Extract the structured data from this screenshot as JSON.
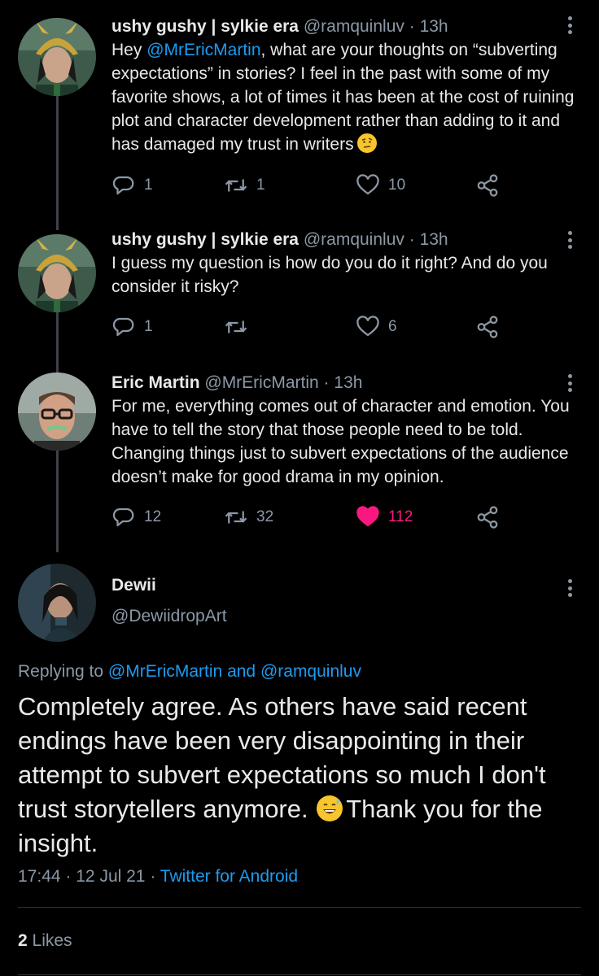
{
  "thread": [
    {
      "name": "ushy gushy | sylkie era",
      "handle": "@ramquinluv",
      "separator": "·",
      "time": "13h",
      "text_before": "Hey ",
      "text_mention": "@MrEricMartin",
      "text_after": ", what are your thoughts on “subverting expectations” in stories? I feel in the past with some of my favorite shows, a lot of times it has been at the cost of ruining plot and character development rather than adding to it and has damaged my trust in writers",
      "emoji": "face-with-raised-eyebrow-icon",
      "replies": "1",
      "retweets": "1",
      "likes": "10",
      "liked": false
    },
    {
      "name": "ushy gushy | sylkie era",
      "handle": "@ramquinluv",
      "separator": "·",
      "time": "13h",
      "text": "I guess my question is how do you do it right? And do you consider it risky?",
      "replies": "1",
      "retweets": "",
      "likes": "6",
      "liked": false
    },
    {
      "name": "Eric Martin",
      "handle": "@MrEricMartin",
      "separator": "·",
      "time": "13h",
      "text": "For me, everything comes out of character and emotion. You have to tell the story that those people need to be told. Changing things just to subvert expectations of the audience doesn’t make for good drama in my opinion.",
      "replies": "12",
      "retweets": "32",
      "likes": "112",
      "liked": true
    }
  ],
  "main_tweet": {
    "name": "Dewii",
    "handle": "@DewiidropArt",
    "replying_prefix": "Replying to ",
    "replying_user1": "@MrEricMartin",
    "replying_and": " and ",
    "replying_user2": "@ramquinluv",
    "text_before": "Completely agree. As others have said recent endings have been very disappointing in their attempt to subvert expectations so much I don't trust storytellers anymore.",
    "emoji": "grinning-face-with-sweat-icon",
    "text_after": "Thank you for the insight.",
    "time": "17:44",
    "dot": "·",
    "date": "12 Jul 21",
    "source": "Twitter for Android",
    "likes_count": "2",
    "likes_label": "Likes"
  },
  "colors": {
    "background": "#000000",
    "accent_blue": "#1d9bf0",
    "like_pink": "#f91880",
    "muted": "#8b98a5"
  }
}
